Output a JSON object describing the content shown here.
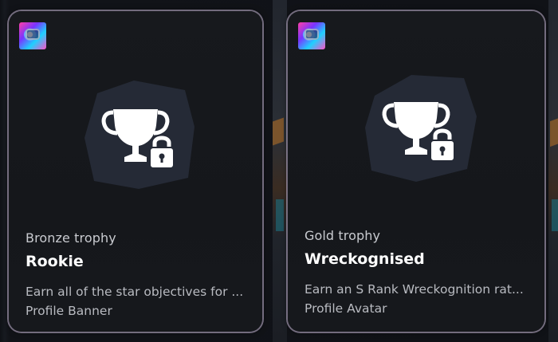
{
  "cards": [
    {
      "trophy_type": "Bronze trophy",
      "trophy_name": "Rookie",
      "description": "Earn all of the star objectives for ...",
      "reward": "Profile Banner",
      "locked": true
    },
    {
      "trophy_type": "Gold trophy",
      "trophy_name": "Wreckognised",
      "description": "Earn an S Rank Wreckognition rat...",
      "reward": "Profile Avatar",
      "locked": true
    }
  ],
  "icons": {
    "game": "game-thumbnail-icon",
    "trophy": "trophy-icon",
    "lock": "lock-icon"
  },
  "colors": {
    "card_border": "#c8b9d7",
    "emblem_fill": "#252a36",
    "text_primary": "#ffffff",
    "text_secondary": "#b9bbc1"
  }
}
